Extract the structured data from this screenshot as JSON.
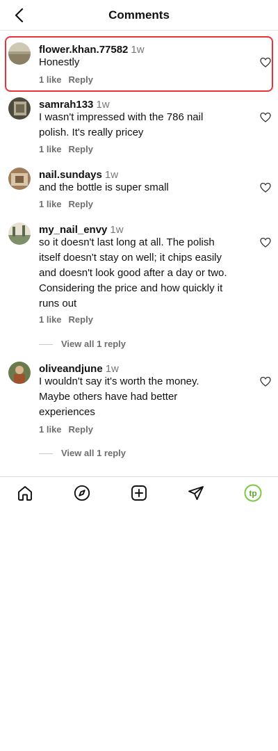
{
  "header": {
    "title": "Comments",
    "back_icon": "chevron-left-icon"
  },
  "comments": [
    {
      "username": "flower.khan.77582",
      "time": "1w",
      "text": [
        "Honestly"
      ],
      "likes": "1 like",
      "reply_label": "Reply",
      "highlighted": true
    },
    {
      "username": "samrah133",
      "time": "1w",
      "text": [
        "I wasn't impressed with the 786 nail",
        "polish. It's really pricey"
      ],
      "likes": "1 like",
      "reply_label": "Reply"
    },
    {
      "username": "nail.sundays",
      "time": "1w",
      "text": [
        "and the bottle is super small"
      ],
      "likes": "1 like",
      "reply_label": "Reply"
    },
    {
      "username": "my_nail_envy",
      "time": "1w",
      "text": [
        "so it doesn't last long at all. The polish",
        "itself doesn't stay on well; it chips easily",
        "and doesn't look good after a day or two.",
        "Considering the price and how quickly it",
        "runs out"
      ],
      "likes": "1 like",
      "reply_label": "Reply",
      "view_replies": "View all 1 reply"
    },
    {
      "username": "oliveandjune",
      "time": "1w",
      "text": [
        "I wouldn't say it's worth the money.",
        "Maybe others have had better",
        "experiences"
      ],
      "likes": "1 like",
      "reply_label": "Reply",
      "view_replies": "View all 1 reply"
    }
  ],
  "nav": {
    "items": [
      "home-icon",
      "explore-compass-icon",
      "create-plus-icon",
      "send-icon",
      "profile-avatar"
    ],
    "profile_initials": "tp",
    "profile_color": "#7ac943"
  },
  "colors": {
    "highlight": "#e8333b",
    "secondary_text": "#6e6e6e"
  }
}
